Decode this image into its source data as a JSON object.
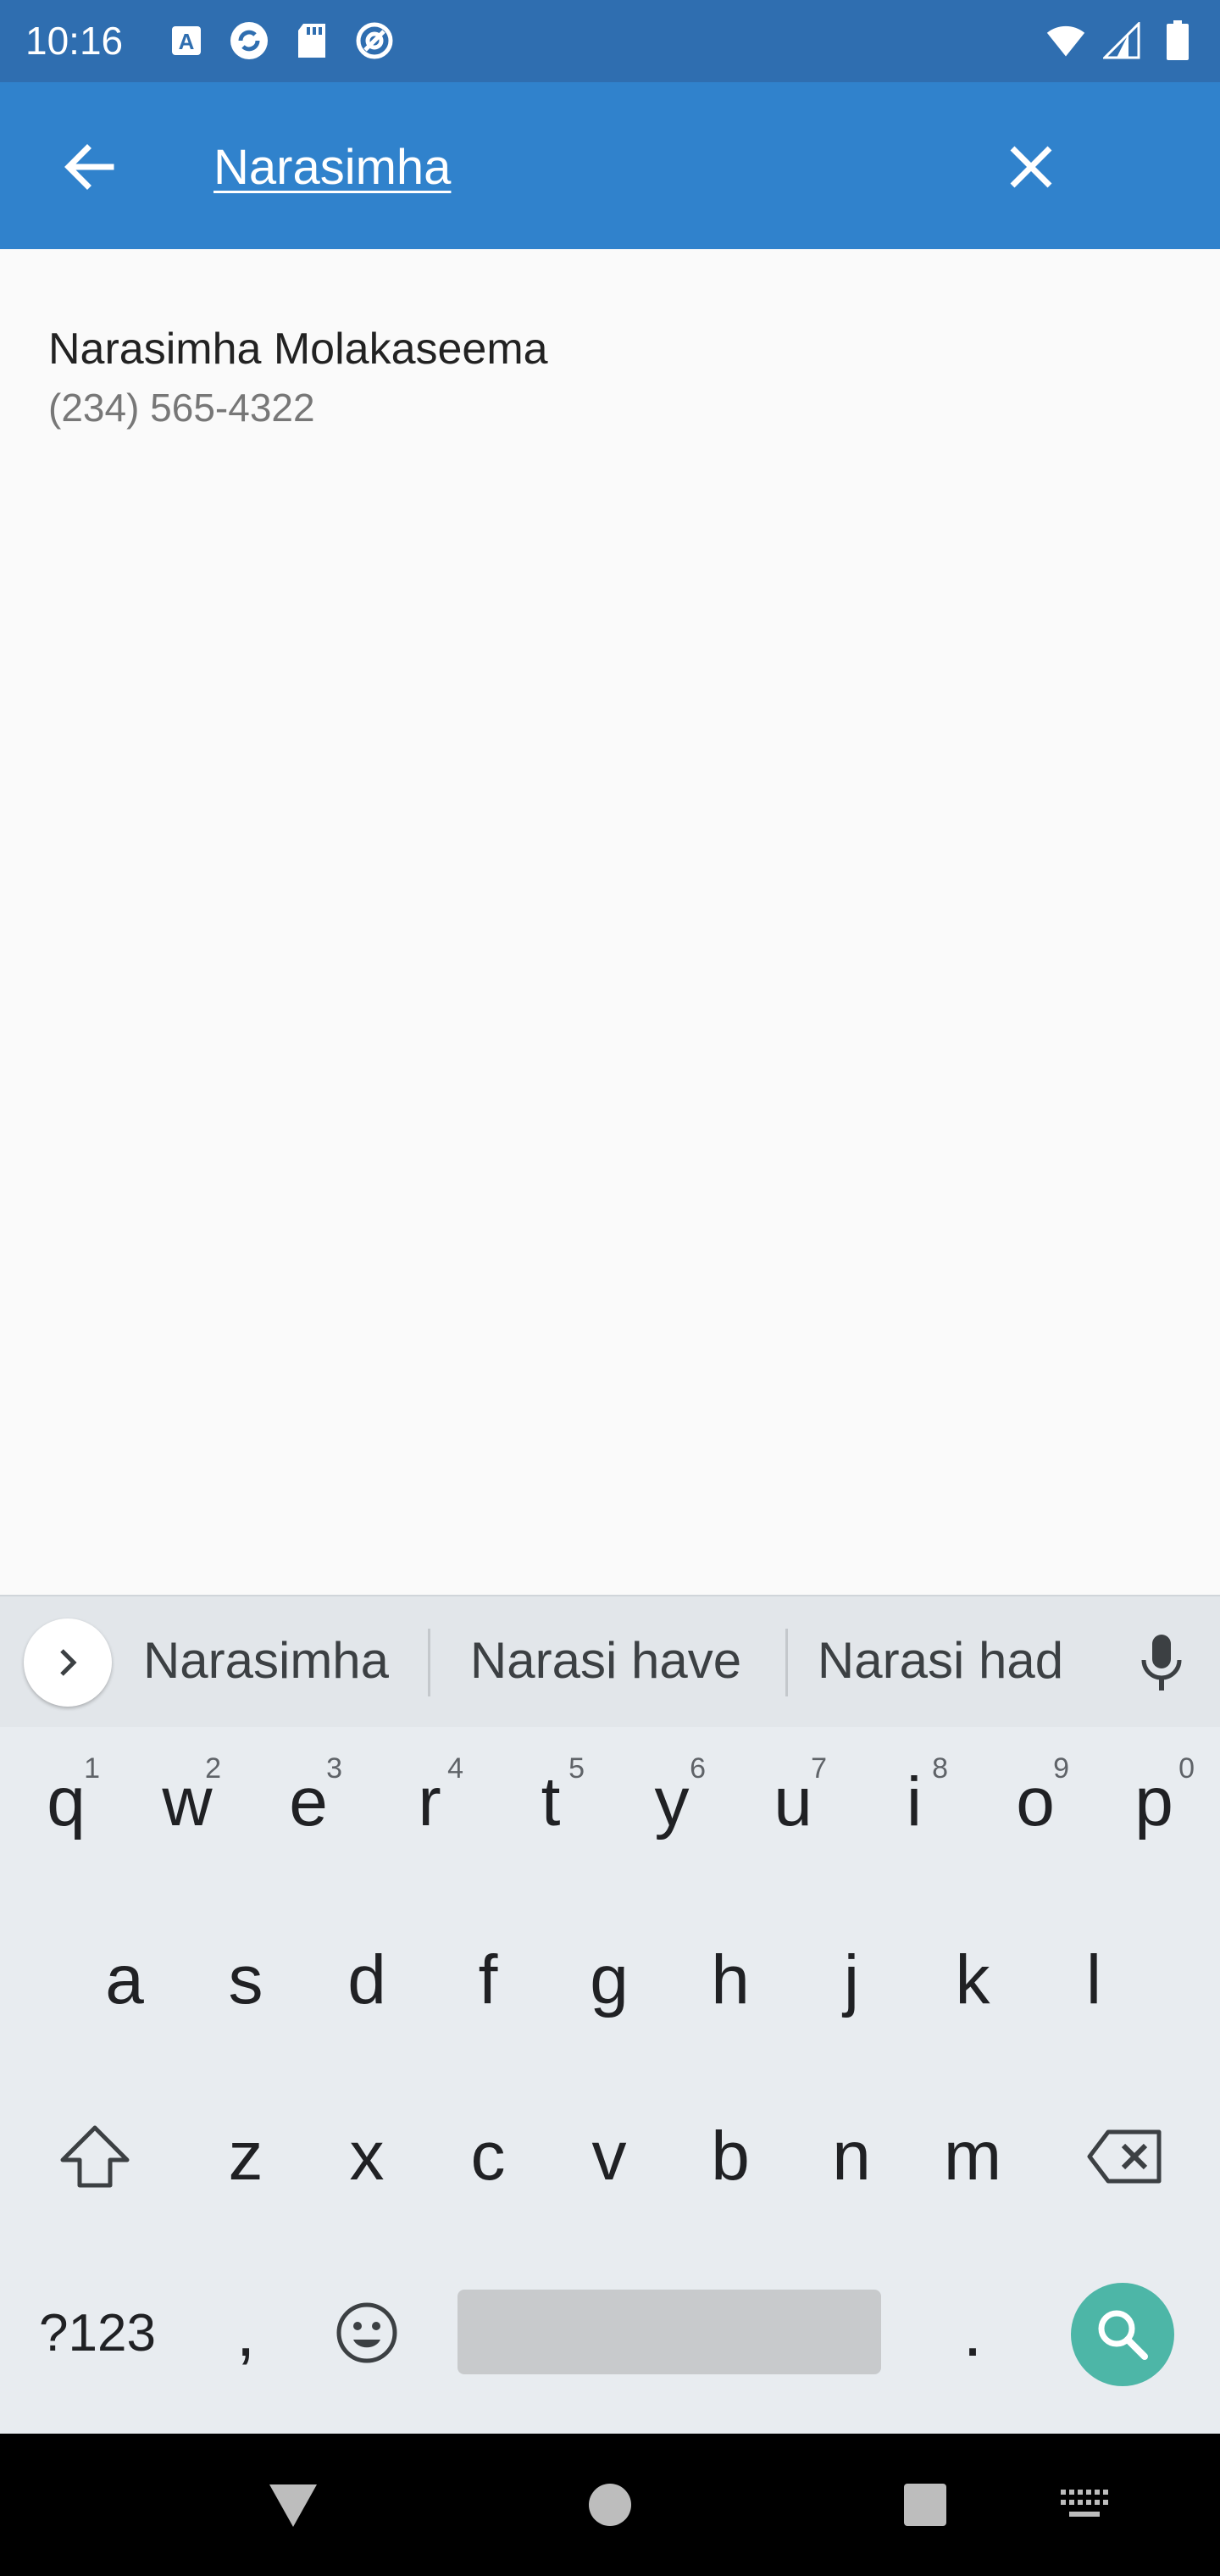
{
  "status_bar": {
    "time": "10:16",
    "left_icons": [
      "a-box-icon",
      "sync-icon",
      "sd-card-icon",
      "at-circle-icon"
    ],
    "right_icons": [
      "wifi-icon",
      "signal-icon",
      "battery-icon"
    ]
  },
  "app_bar": {
    "search_value": "Narasimha",
    "back_icon": "arrow-left-icon",
    "clear_icon": "close-icon",
    "color": "#3082cc"
  },
  "results": [
    {
      "name": "Narasimha Molakaseema",
      "phone": "(234) 565-4322"
    }
  ],
  "keyboard": {
    "suggestions": [
      "Narasimha",
      "Narasi have",
      "Narasi had"
    ],
    "row1": [
      {
        "k": "q",
        "h": "1"
      },
      {
        "k": "w",
        "h": "2"
      },
      {
        "k": "e",
        "h": "3"
      },
      {
        "k": "r",
        "h": "4"
      },
      {
        "k": "t",
        "h": "5"
      },
      {
        "k": "y",
        "h": "6"
      },
      {
        "k": "u",
        "h": "7"
      },
      {
        "k": "i",
        "h": "8"
      },
      {
        "k": "o",
        "h": "9"
      },
      {
        "k": "p",
        "h": "0"
      }
    ],
    "row2": [
      "a",
      "s",
      "d",
      "f",
      "g",
      "h",
      "j",
      "k",
      "l"
    ],
    "row3": [
      "z",
      "x",
      "c",
      "v",
      "b",
      "n",
      "m"
    ],
    "symbols_label": "?123",
    "comma_label": ",",
    "period_label": ".",
    "action_color": "#4db6a7"
  },
  "nav_bar": {
    "icons": [
      "back-triangle-icon",
      "home-circle-icon",
      "recents-square-icon",
      "keyboard-icon"
    ]
  }
}
